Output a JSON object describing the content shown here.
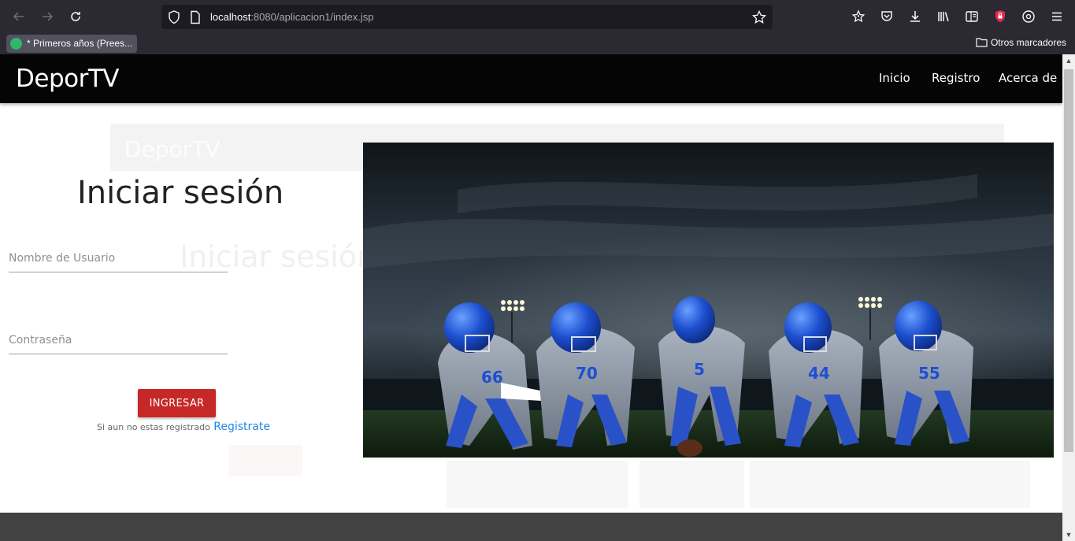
{
  "browser": {
    "url_host": "localhost",
    "url_rest": ":8080/aplicacion1/index.jsp",
    "bookmark_tab": "* Primeros años (Prees...",
    "other_bookmarks": "Otros marcadores"
  },
  "site": {
    "brand": "DeporTV",
    "nav": [
      "Inicio",
      "Registro",
      "Acerca de"
    ]
  },
  "ghost": {
    "brand": "DeporTV",
    "title": "Iniciar sesión"
  },
  "login": {
    "title": "Iniciar sesión",
    "username_placeholder": "Nombre de Usuario",
    "password_placeholder": "Contraseña",
    "submit_label": "INGRESAR",
    "register_prompt": "Si aun no estas registrado",
    "register_link": "Registrate"
  },
  "hero": {
    "players": [
      "66",
      "70",
      "5",
      "44",
      "55"
    ],
    "accent": "#1e5fd8"
  },
  "colors": {
    "navbar": "#050505",
    "button": "#c62828",
    "link": "#1e88e5",
    "footer": "#424242",
    "chrome": "#2b2a33"
  }
}
